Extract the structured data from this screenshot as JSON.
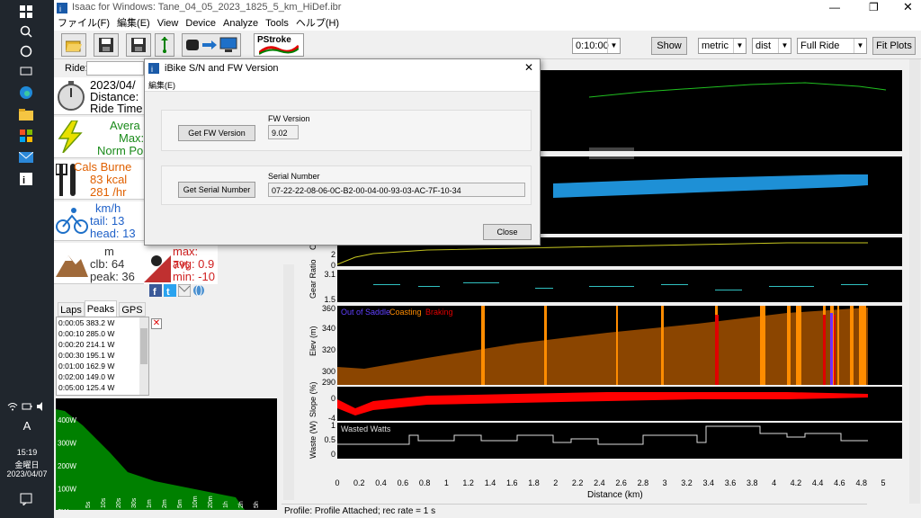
{
  "taskbar": {
    "time": "15:19",
    "weekday": "金曜日",
    "date": "2023/04/07",
    "ime": "A"
  },
  "window": {
    "title": "Isaac for Windows: Tane_04_05_2023_1825_5_km_HiDef.ibr"
  },
  "menu": [
    "ファイル(F)",
    "編集(E)",
    "View",
    "Device",
    "Analyze",
    "Tools",
    "ヘルプ(H)"
  ],
  "toolbar": {
    "pstroke_label": "PStroke",
    "time_value": "0:10:00",
    "show_label": "Show",
    "units_value": "metric",
    "axis_value": "dist",
    "range_value": "Full Ride",
    "fit_label": "Fit Plots"
  },
  "ride": {
    "label": "Ride:"
  },
  "metrics": {
    "date": "2023/04/",
    "distance": "Distance:",
    "ride_time": "Ride Time",
    "power1": "Avera",
    "power2": "Max:",
    "power3": "Norm Po",
    "cals1": "Cals Burne",
    "cals2": "83 kcal",
    "cals3": "281 /hr",
    "wind1": "km/h",
    "wind2": "tail: 13",
    "wind3": "head: 13",
    "climb1": "m",
    "climb2": "clb: 64",
    "climb3": "peak: 36",
    "slope1": "max: 7%",
    "slope2": "avg: 0.9",
    "slope3": "min: -10"
  },
  "tabs": [
    "Laps",
    "Peaks",
    "GPS"
  ],
  "peaks": [
    "0:00:05 383.2 W",
    "0:00:10 285.0 W",
    "0:00:20 214.1 W",
    "0:00:30 195.1 W",
    "0:01:00 162.9 W",
    "0:02:00 149.0 W",
    "0:05:00 125.4 W"
  ],
  "power_chart": {
    "y_ticks": [
      "400W",
      "300W",
      "200W",
      "100W",
      "0W"
    ],
    "x_ticks": [
      "5s",
      "10s",
      "20s",
      "30s",
      "1m",
      "2m",
      "5m",
      "10m",
      "20m",
      "1h",
      "2h",
      "5h"
    ]
  },
  "plots": {
    "gear_label": "Gear Ratio",
    "cad_label": "Cad",
    "elev_label": "Elev (m)",
    "slope_label": "Slope (%)",
    "waste_label": "Waste (W)",
    "elev_legend": {
      "out_of_saddle": "Out of Saddle",
      "coasting": "Coasting",
      "braking": "Braking"
    },
    "waste_legend": "Wasted Watts",
    "cad_ticks": [
      "2",
      "0"
    ],
    "gear_ticks": [
      "3.1",
      "1.5"
    ],
    "elev_ticks": [
      "360",
      "340",
      "320",
      "300",
      "290"
    ],
    "slope_ticks": [
      "0",
      "-4"
    ],
    "waste_ticks": [
      "1",
      "0.5",
      "0"
    ],
    "x_ticks": [
      "0",
      "0.2",
      "0.4",
      "0.6",
      "0.8",
      "1",
      "1.2",
      "1.4",
      "1.6",
      "1.8",
      "2",
      "2.2",
      "2.4",
      "2.6",
      "2.8",
      "3",
      "3.2",
      "3.4",
      "3.6",
      "3.8",
      "4",
      "4.2",
      "4.4",
      "4.6",
      "4.8",
      "5"
    ],
    "x_label": "Distance (km)"
  },
  "status": "Profile: Profile Attached; rec rate = 1 s",
  "dialog": {
    "title": "iBike S/N and FW Version",
    "menu": "編集(E)",
    "fw_button": "Get FW Version",
    "fw_label": "FW Version",
    "fw_value": "9.02",
    "sn_button": "Get Serial Number",
    "sn_label": "Serial Number",
    "sn_value": "07-22-22-08-06-0C-B2-00-04-00-93-03-AC-7F-10-34",
    "close_label": "Close"
  },
  "colors": {
    "taskbar": "#20262d",
    "power_fill": "#008000",
    "speed_band": "#1e90d6",
    "elev_fill": "#8b4500",
    "coasting": "#ff8c00",
    "braking": "#e00000",
    "slope": "#ff0000"
  }
}
